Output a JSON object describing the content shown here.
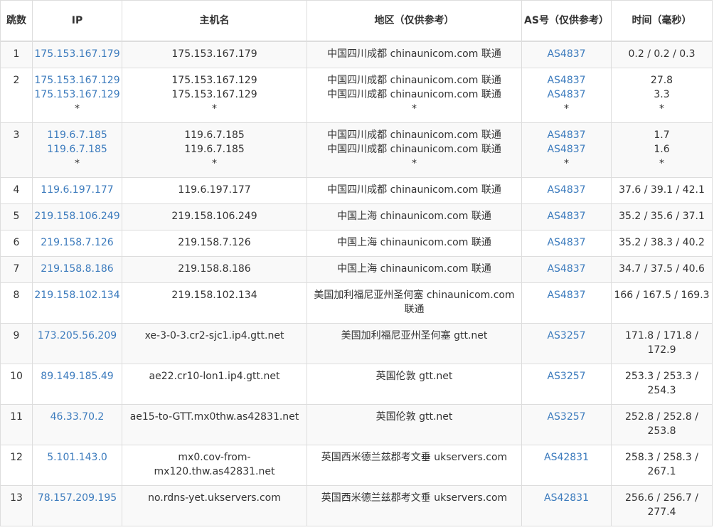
{
  "headers": {
    "hop": "跳数",
    "ip": "IP",
    "hostname": "主机名",
    "region": "地区（仅供参考）",
    "asn": "AS号（仅供参考）",
    "time": "时间（毫秒）"
  },
  "rows": [
    {
      "hop": "1",
      "ip": [
        "175.153.167.179"
      ],
      "host": [
        "175.153.167.179"
      ],
      "region": [
        "中国四川成都 chinaunicom.com 联通"
      ],
      "asn": [
        "AS4837"
      ],
      "time": [
        "0.2 / 0.2 / 0.3"
      ]
    },
    {
      "hop": "2",
      "ip": [
        "175.153.167.129",
        "175.153.167.129",
        "*"
      ],
      "host": [
        "175.153.167.129",
        "175.153.167.129",
        "*"
      ],
      "region": [
        "中国四川成都 chinaunicom.com 联通",
        "中国四川成都 chinaunicom.com 联通",
        "*"
      ],
      "asn": [
        "AS4837",
        "AS4837",
        "*"
      ],
      "time": [
        "27.8",
        "3.3",
        "*"
      ]
    },
    {
      "hop": "3",
      "ip": [
        "119.6.7.185",
        "119.6.7.185",
        "*"
      ],
      "host": [
        "119.6.7.185",
        "119.6.7.185",
        "*"
      ],
      "region": [
        "中国四川成都 chinaunicom.com 联通",
        "中国四川成都 chinaunicom.com 联通",
        "*"
      ],
      "asn": [
        "AS4837",
        "AS4837",
        "*"
      ],
      "time": [
        "1.7",
        "1.6",
        "*"
      ]
    },
    {
      "hop": "4",
      "ip": [
        "119.6.197.177"
      ],
      "host": [
        "119.6.197.177"
      ],
      "region": [
        "中国四川成都 chinaunicom.com 联通"
      ],
      "asn": [
        "AS4837"
      ],
      "time": [
        "37.6 / 39.1 / 42.1"
      ]
    },
    {
      "hop": "5",
      "ip": [
        "219.158.106.249"
      ],
      "host": [
        "219.158.106.249"
      ],
      "region": [
        "中国上海 chinaunicom.com 联通"
      ],
      "asn": [
        "AS4837"
      ],
      "time": [
        "35.2 / 35.6 / 37.1"
      ]
    },
    {
      "hop": "6",
      "ip": [
        "219.158.7.126"
      ],
      "host": [
        "219.158.7.126"
      ],
      "region": [
        "中国上海 chinaunicom.com 联通"
      ],
      "asn": [
        "AS4837"
      ],
      "time": [
        "35.2 / 38.3 / 40.2"
      ]
    },
    {
      "hop": "7",
      "ip": [
        "219.158.8.186"
      ],
      "host": [
        "219.158.8.186"
      ],
      "region": [
        "中国上海 chinaunicom.com 联通"
      ],
      "asn": [
        "AS4837"
      ],
      "time": [
        "34.7 / 37.5 / 40.6"
      ]
    },
    {
      "hop": "8",
      "ip": [
        "219.158.102.134"
      ],
      "host": [
        "219.158.102.134"
      ],
      "region": [
        "美国加利福尼亚州圣何塞 chinaunicom.com 联通"
      ],
      "asn": [
        "AS4837"
      ],
      "time": [
        "166 / 167.5 / 169.3"
      ]
    },
    {
      "hop": "9",
      "ip": [
        "173.205.56.209"
      ],
      "host": [
        "xe-3-0-3.cr2-sjc1.ip4.gtt.net"
      ],
      "region": [
        "美国加利福尼亚州圣何塞 gtt.net"
      ],
      "asn": [
        "AS3257"
      ],
      "time": [
        "171.8 / 171.8 / 172.9"
      ]
    },
    {
      "hop": "10",
      "ip": [
        "89.149.185.49"
      ],
      "host": [
        "ae22.cr10-lon1.ip4.gtt.net"
      ],
      "region": [
        "英国伦敦 gtt.net"
      ],
      "asn": [
        "AS3257"
      ],
      "time": [
        "253.3 / 253.3 / 254.3"
      ]
    },
    {
      "hop": "11",
      "ip": [
        "46.33.70.2"
      ],
      "host": [
        "ae15-to-GTT.mx0thw.as42831.net"
      ],
      "region": [
        "英国伦敦 gtt.net"
      ],
      "asn": [
        "AS3257"
      ],
      "time": [
        "252.8 / 252.8 / 253.8"
      ]
    },
    {
      "hop": "12",
      "ip": [
        "5.101.143.0"
      ],
      "host": [
        "mx0.cov-from-mx120.thw.as42831.net"
      ],
      "region": [
        "英国西米德兰兹郡考文垂 ukservers.com"
      ],
      "asn": [
        "AS42831"
      ],
      "time": [
        "258.3 / 258.3 / 267.1"
      ]
    },
    {
      "hop": "13",
      "ip": [
        "78.157.209.195"
      ],
      "host": [
        "no.rdns-yet.ukservers.com"
      ],
      "region": [
        "英国西米德兰兹郡考文垂 ukservers.com"
      ],
      "asn": [
        "AS42831"
      ],
      "time": [
        "256.6 / 256.7 / 277.4"
      ]
    }
  ],
  "colors": {
    "link": "#3c7bbd",
    "border": "#dddddd",
    "stripe": "#f9f9f9",
    "text": "#333333"
  }
}
